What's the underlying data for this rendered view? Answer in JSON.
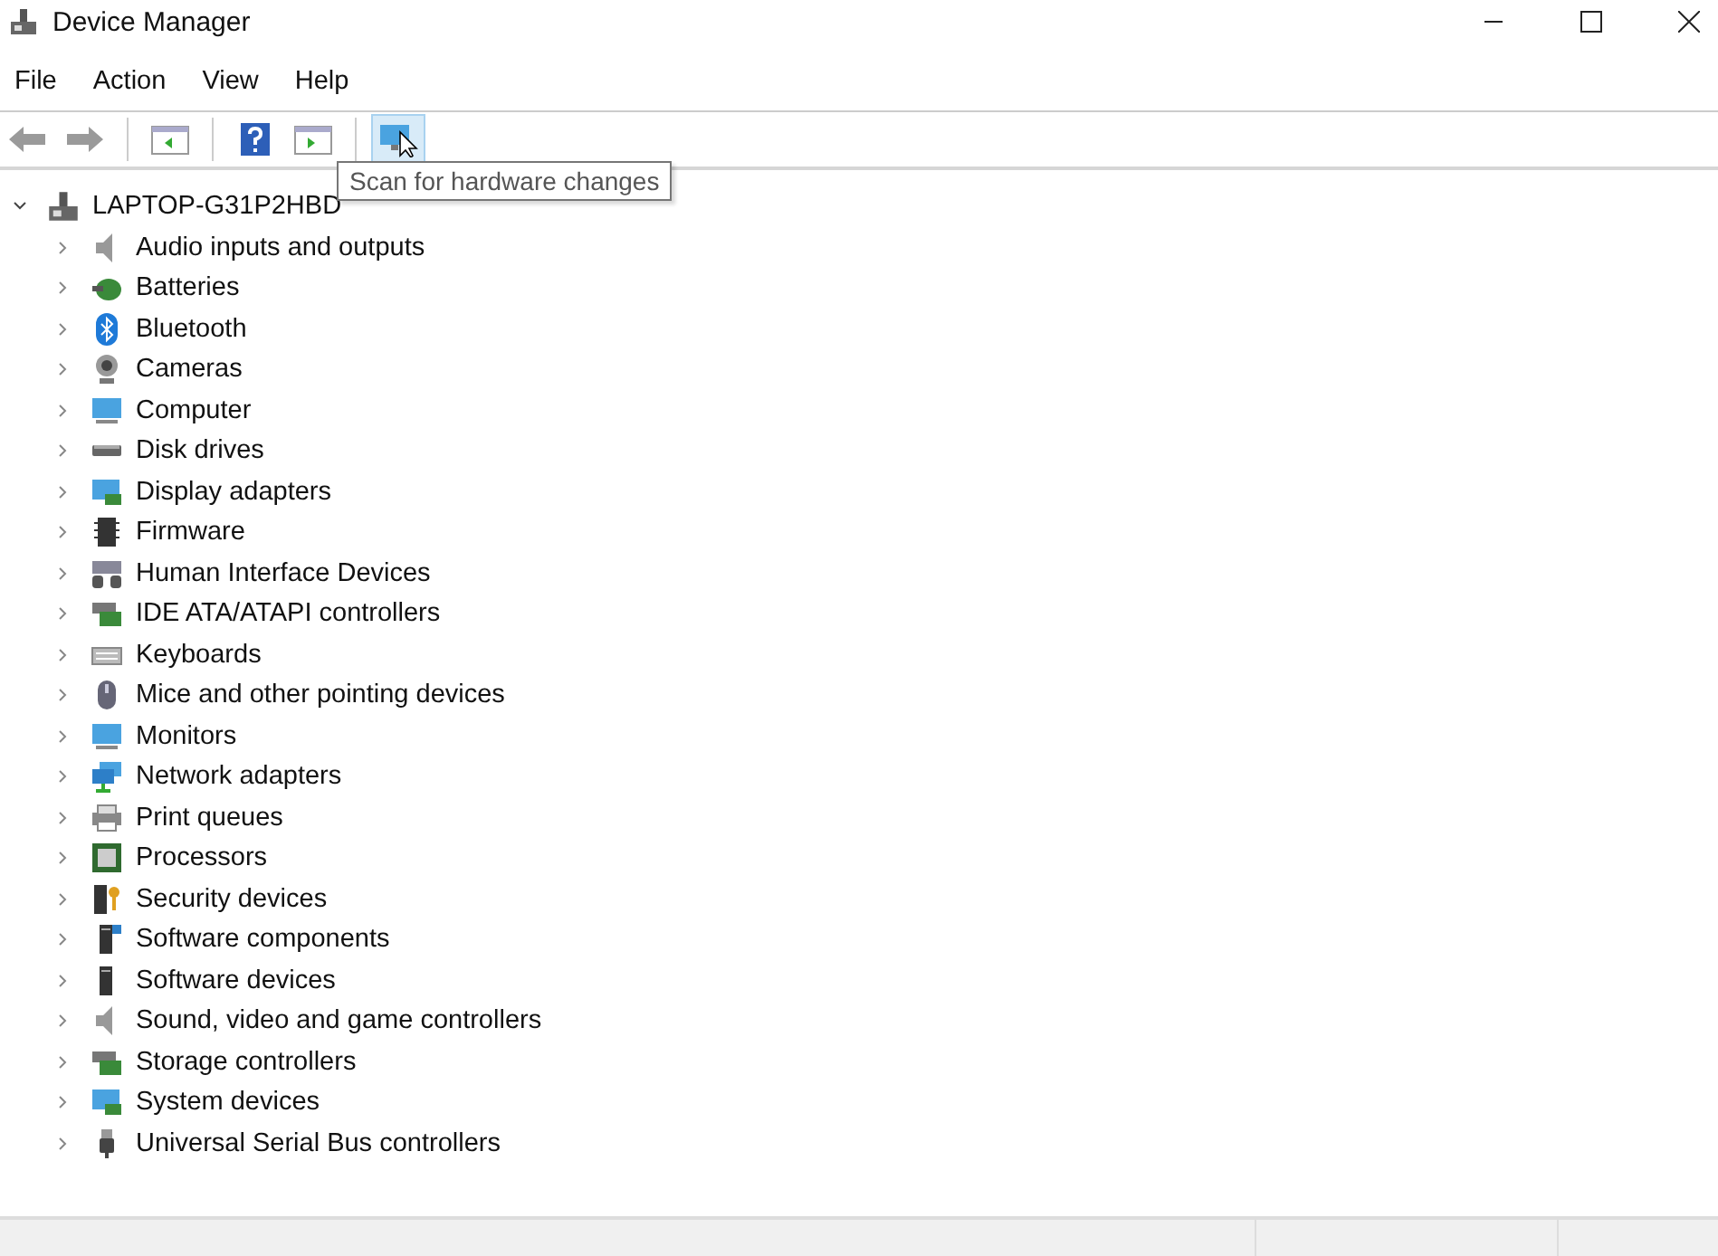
{
  "window": {
    "title": "Device Manager"
  },
  "menu": [
    "File",
    "Action",
    "View",
    "Help"
  ],
  "toolbar": [
    {
      "kind": "back",
      "hovered": false
    },
    {
      "kind": "forward",
      "hovered": false
    },
    {
      "kind": "separator"
    },
    {
      "kind": "pane",
      "hovered": false
    },
    {
      "kind": "separator"
    },
    {
      "kind": "help",
      "hovered": false
    },
    {
      "kind": "pane2",
      "hovered": false
    },
    {
      "kind": "separator"
    },
    {
      "kind": "scan",
      "hovered": true
    }
  ],
  "tooltip": "Scan for hardware changes",
  "tree": {
    "label": "LAPTOP-G31P2HBD",
    "expanded": true,
    "children": [
      {
        "label": "Audio inputs and outputs",
        "expanded": false
      },
      {
        "label": "Batteries",
        "expanded": false
      },
      {
        "label": "Bluetooth",
        "expanded": false
      },
      {
        "label": "Cameras",
        "expanded": false
      },
      {
        "label": "Computer",
        "expanded": false
      },
      {
        "label": "Disk drives",
        "expanded": false
      },
      {
        "label": "Display adapters",
        "expanded": false
      },
      {
        "label": "Firmware",
        "expanded": false
      },
      {
        "label": "Human Interface Devices",
        "expanded": false
      },
      {
        "label": "IDE ATA/ATAPI controllers",
        "expanded": false
      },
      {
        "label": "Keyboards",
        "expanded": false
      },
      {
        "label": "Mice and other pointing devices",
        "expanded": false
      },
      {
        "label": "Monitors",
        "expanded": false
      },
      {
        "label": "Network adapters",
        "expanded": false
      },
      {
        "label": "Print queues",
        "expanded": false
      },
      {
        "label": "Processors",
        "expanded": false
      },
      {
        "label": "Security devices",
        "expanded": false
      },
      {
        "label": "Software components",
        "expanded": false
      },
      {
        "label": "Software devices",
        "expanded": false
      },
      {
        "label": "Sound, video and game controllers",
        "expanded": false
      },
      {
        "label": "Storage controllers",
        "expanded": false
      },
      {
        "label": "System devices",
        "expanded": false
      },
      {
        "label": "Universal Serial Bus controllers",
        "expanded": false
      }
    ]
  }
}
